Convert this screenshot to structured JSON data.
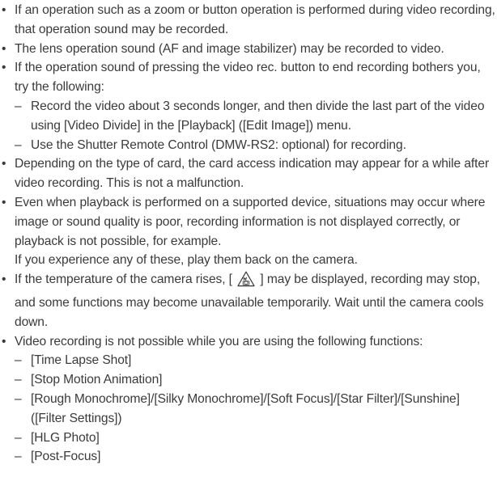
{
  "bullet_symbol": "•",
  "dash_symbol": "–",
  "items": [
    {
      "text": "If an operation such as a zoom or button operation is performed during video recording, that operation sound may be recorded."
    },
    {
      "text": "The lens operation sound (AF and image stabilizer) may be recorded to video."
    },
    {
      "text": "If the operation sound of pressing the video rec. button to end recording bothers you, try the following:",
      "subs": [
        "Record the video about 3 seconds longer, and then divide the last part of the video using [Video Divide] in the [Playback] ([Edit Image]) menu.",
        "Use the Shutter Remote Control (DMW-RS2: optional) for recording."
      ]
    },
    {
      "text": "Depending on the type of card, the card access indication may appear for a while after video recording. This is not a malfunction."
    },
    {
      "text": "Even when playback is performed on a supported device, situations may occur where image or sound quality is poor, recording information is not displayed correctly, or playback is not possible, for example.",
      "continuation": "If you experience any of these, play them back on the camera."
    },
    {
      "text_before_icon": "If the temperature of the camera rises, [ ",
      "icon": "temperature-warning-icon",
      "text_after_icon": " ] may be displayed, recording may stop, and some functions may become unavailable temporarily. Wait until the camera cools down."
    },
    {
      "text": "Video recording is not possible while you are using the following functions:",
      "subs": [
        "[Time Lapse Shot]",
        "[Stop Motion Animation]",
        "[Rough Monochrome]/[Silky Monochrome]/[Soft Focus]/[Star Filter]/[Sunshine] ([Filter Settings])",
        "[HLG Photo]",
        "[Post-Focus]"
      ]
    }
  ],
  "colors": {
    "text": "#3a3a3a",
    "icon": "#3a3a3a"
  }
}
